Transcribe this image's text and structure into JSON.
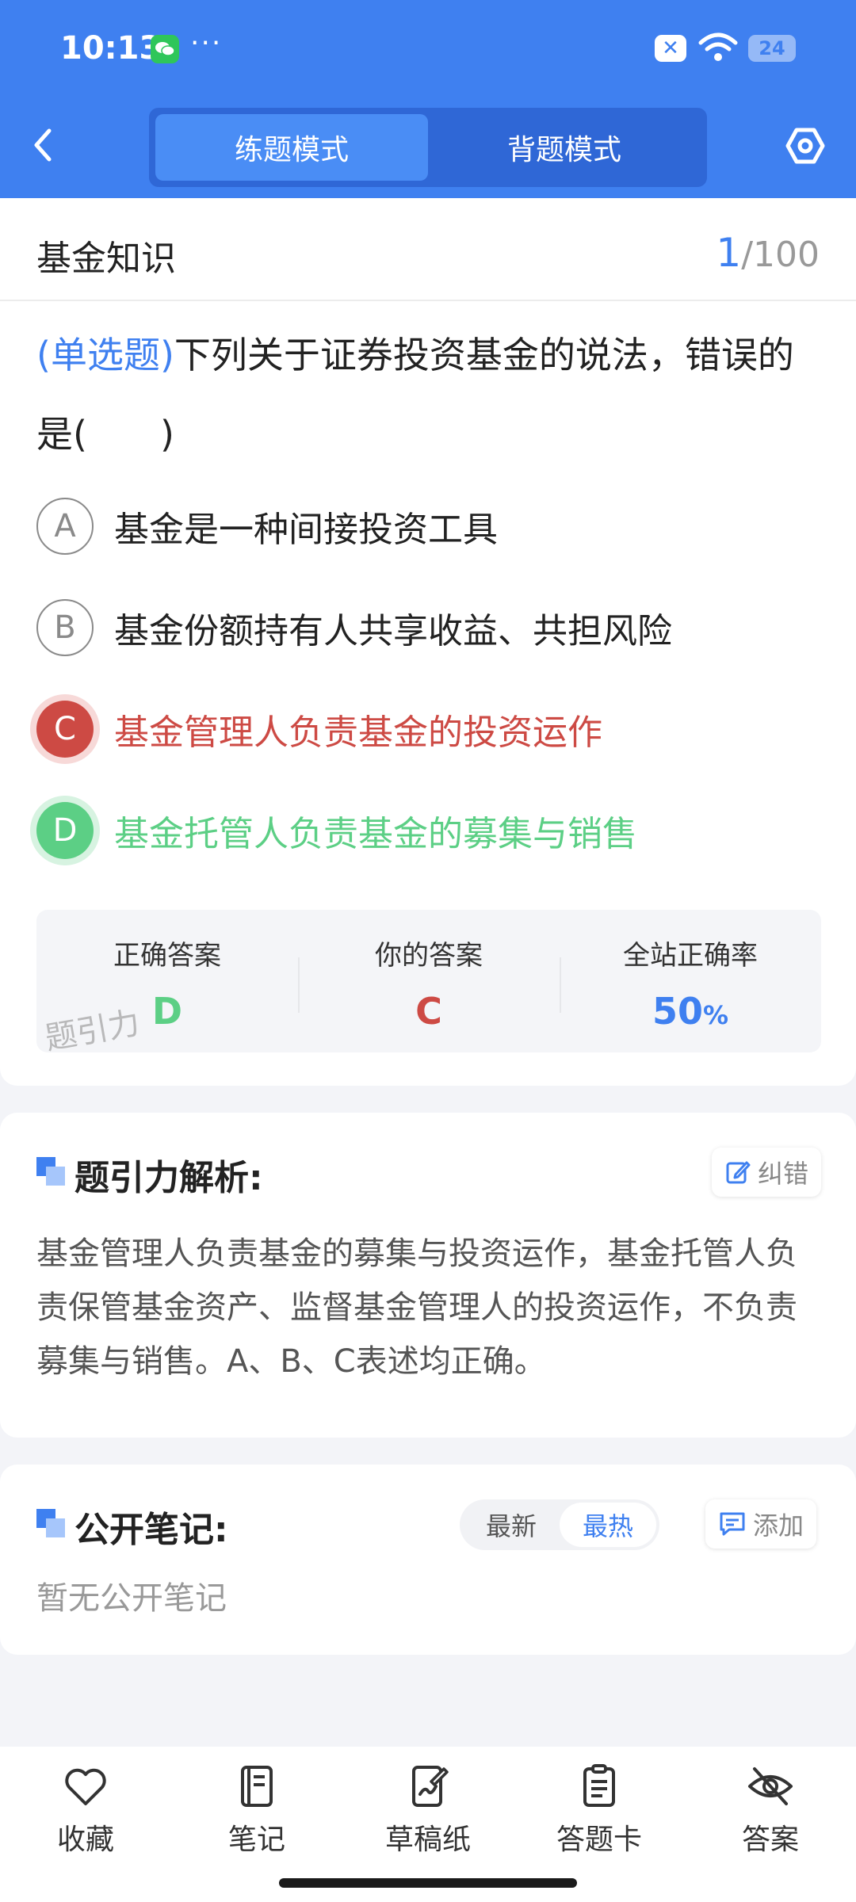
{
  "status_bar": {
    "time": "10:13",
    "dots": "···",
    "battery": "24"
  },
  "header": {
    "tabs": [
      {
        "label": "练题模式",
        "active": true
      },
      {
        "label": "背题模式",
        "active": false
      }
    ]
  },
  "question": {
    "subject": "基金知识",
    "current": "1",
    "total": "/100",
    "type": "(单选题)",
    "text": "下列关于证券投资基金的说法，错误的是(　　)",
    "options": [
      {
        "letter": "A",
        "text": "基金是一种间接投资工具",
        "state": "normal"
      },
      {
        "letter": "B",
        "text": "基金份额持有人共享收益、共担风险",
        "state": "normal"
      },
      {
        "letter": "C",
        "text": "基金管理人负责基金的投资运作",
        "state": "wrong"
      },
      {
        "letter": "D",
        "text": "基金托管人负责基金的募集与销售",
        "state": "correct"
      }
    ]
  },
  "answer_summary": {
    "correct_label": "正确答案",
    "correct_value": "D",
    "yours_label": "你的答案",
    "yours_value": "C",
    "rate_label": "全站正确率",
    "rate_value": "50",
    "rate_unit": "%",
    "watermark": "题引力"
  },
  "analysis": {
    "title": "题引力解析:",
    "report_label": "纠错",
    "text": "基金管理人负责基金的募集与投资运作，基金托管人负责保管基金资产、监督基金管理人的投资运作，不负责募集与销售。A、B、C表述均正确。"
  },
  "notes": {
    "title": "公开笔记:",
    "sort_tabs": [
      {
        "label": "最新",
        "active": false
      },
      {
        "label": "最热",
        "active": true
      }
    ],
    "add_label": "添加",
    "empty_text": "暂无公开笔记"
  },
  "bottom_bar": {
    "items": [
      {
        "label": "收藏",
        "icon": "heart-icon"
      },
      {
        "label": "笔记",
        "icon": "notebook-icon"
      },
      {
        "label": "草稿纸",
        "icon": "draft-paper-icon"
      },
      {
        "label": "答题卡",
        "icon": "answer-sheet-icon"
      },
      {
        "label": "答案",
        "icon": "eye-off-icon"
      }
    ]
  },
  "colors": {
    "primary": "#3f80f0",
    "wrong": "#cd4a44",
    "correct": "#5ccf85"
  }
}
